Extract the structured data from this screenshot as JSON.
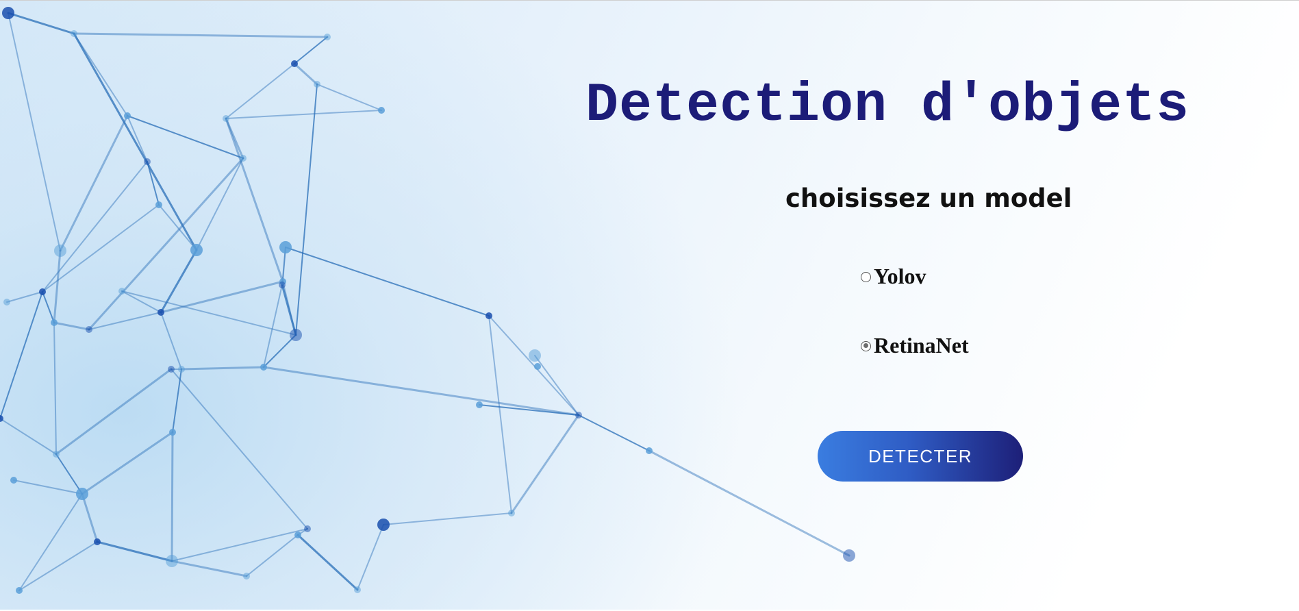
{
  "header": {
    "title": "Detection d'objets"
  },
  "form": {
    "prompt": "choisissez un model",
    "options": [
      {
        "label": "Yolov",
        "checked": false
      },
      {
        "label": "RetinaNet",
        "checked": true
      }
    ],
    "submit_label": "DETECTER"
  },
  "colors": {
    "title": "#1c1c78",
    "button_start": "#3a7de0",
    "button_end": "#1d1f78",
    "network_lines": "#2a6fb8"
  }
}
